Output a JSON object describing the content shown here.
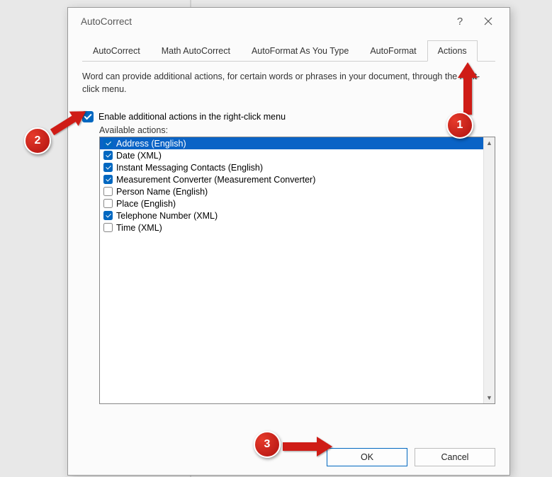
{
  "dialog": {
    "title": "AutoCorrect",
    "help_label": "?",
    "close_label": "✕"
  },
  "tabs": [
    {
      "label": "AutoCorrect",
      "active": false
    },
    {
      "label": "Math AutoCorrect",
      "active": false
    },
    {
      "label": "AutoFormat As You Type",
      "active": false
    },
    {
      "label": "AutoFormat",
      "active": false
    },
    {
      "label": "Actions",
      "active": true
    }
  ],
  "description": "Word can provide additional actions, for certain words or phrases in your document, through the right-click menu.",
  "enable_checkbox": {
    "checked": true,
    "label": "Enable additional actions in the right-click menu"
  },
  "available_label": "Available actions:",
  "actions": [
    {
      "checked": true,
      "selected": true,
      "label": "Address (English)"
    },
    {
      "checked": true,
      "selected": false,
      "label": "Date (XML)"
    },
    {
      "checked": true,
      "selected": false,
      "label": "Instant Messaging Contacts (English)"
    },
    {
      "checked": true,
      "selected": false,
      "label": "Measurement Converter (Measurement Converter)"
    },
    {
      "checked": false,
      "selected": false,
      "label": "Person Name (English)"
    },
    {
      "checked": false,
      "selected": false,
      "label": "Place (English)"
    },
    {
      "checked": true,
      "selected": false,
      "label": "Telephone Number (XML)"
    },
    {
      "checked": false,
      "selected": false,
      "label": "Time (XML)"
    }
  ],
  "buttons": {
    "ok": "OK",
    "cancel": "Cancel"
  },
  "annotations": {
    "badge1": "1",
    "badge2": "2",
    "badge3": "3"
  }
}
